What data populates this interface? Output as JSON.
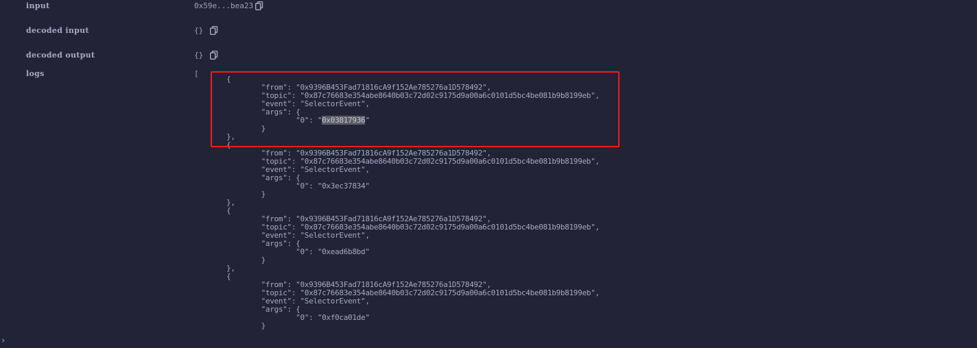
{
  "fields": [
    {
      "label": "input",
      "value": "0x59e...bea23",
      "copy_icon": "copy-icon"
    },
    {
      "label": "decoded input",
      "value": "{}",
      "copy_icon": "copy-icon"
    },
    {
      "label": "decoded output",
      "value": "{}",
      "copy_icon": "copy-icon"
    },
    {
      "label": "logs",
      "value": "["
    }
  ],
  "logs": [
    {
      "from": "0x9396B453Fad71816cA9f152Ae785276a1D578492",
      "topic": "0x87c76683e354abe8640b03c72d02c9175d9a00a6c0101d5bc4be081b9b8199eb",
      "event": "SelectorEvent",
      "args": {
        "0": "0x03817936"
      },
      "highlighted": true
    },
    {
      "from": "0x9396B453Fad71816cA9f152Ae785276a1D578492",
      "topic": "0x87c76683e354abe8640b03c72d02c9175d9a00a6c0101d5bc4be081b9b8199eb",
      "event": "SelectorEvent",
      "args": {
        "0": "0x3ec37834"
      }
    },
    {
      "from": "0x9396B453Fad71816cA9f152Ae785276a1D578492",
      "topic": "0x87c76683e354abe8640b03c72d02c9175d9a00a6c0101d5bc4be081b9b8199eb",
      "event": "SelectorEvent",
      "args": {
        "0": "0xead6b8bd"
      }
    },
    {
      "from": "0x9396B453Fad71816cA9f152Ae785276a1D578492",
      "topic": "0x87c76683e354abe8640b03c72d02c9175d9a00a6c0101d5bc4be081b9b8199eb",
      "event": "SelectorEvent",
      "args": {
        "0": "0xf0ca01de"
      }
    }
  ],
  "selected_text": "0x03817936",
  "annotation_color": "#f21d1d",
  "console_prompt": "›"
}
